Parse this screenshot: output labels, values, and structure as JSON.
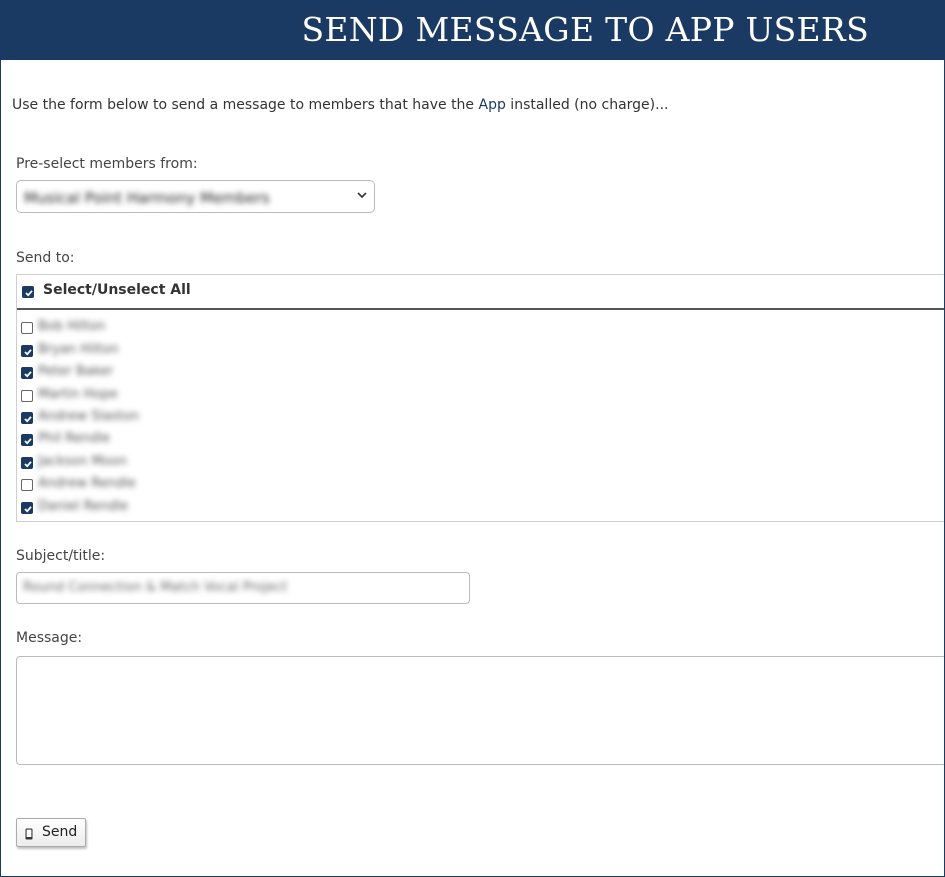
{
  "header": {
    "title": "SEND MESSAGE TO APP USERS"
  },
  "intro": {
    "before": "Use the form below to send a message to members that have the ",
    "link": "App",
    "after": " installed (no charge)..."
  },
  "preselect": {
    "label": "Pre-select members from:",
    "selected_value": "Musical Point Harmony Members"
  },
  "send_to": {
    "label": "Send to:",
    "select_all_label": "Select/Unselect All",
    "select_all_checked": true,
    "members": [
      {
        "name": "Bob Hilton",
        "checked": false
      },
      {
        "name": "Bryan Hilton",
        "checked": true
      },
      {
        "name": "Peter Baker",
        "checked": true
      },
      {
        "name": "Martin Hope",
        "checked": false
      },
      {
        "name": "Andrew Slaston",
        "checked": true
      },
      {
        "name": "Phil Rendle",
        "checked": true
      },
      {
        "name": "Jackson Moon",
        "checked": true
      },
      {
        "name": "Andrew Rendle",
        "checked": false
      },
      {
        "name": "Daniel Rendle",
        "checked": true
      }
    ]
  },
  "subject": {
    "label": "Subject/title:",
    "value": "Round Connection & Match Vocal Project"
  },
  "message": {
    "label": "Message:",
    "value": ""
  },
  "send_button": {
    "label": "Send",
    "icon": "mobile-phone-icon"
  },
  "colors": {
    "header_bg": "#1b3a63",
    "accent": "#1b3a63"
  }
}
